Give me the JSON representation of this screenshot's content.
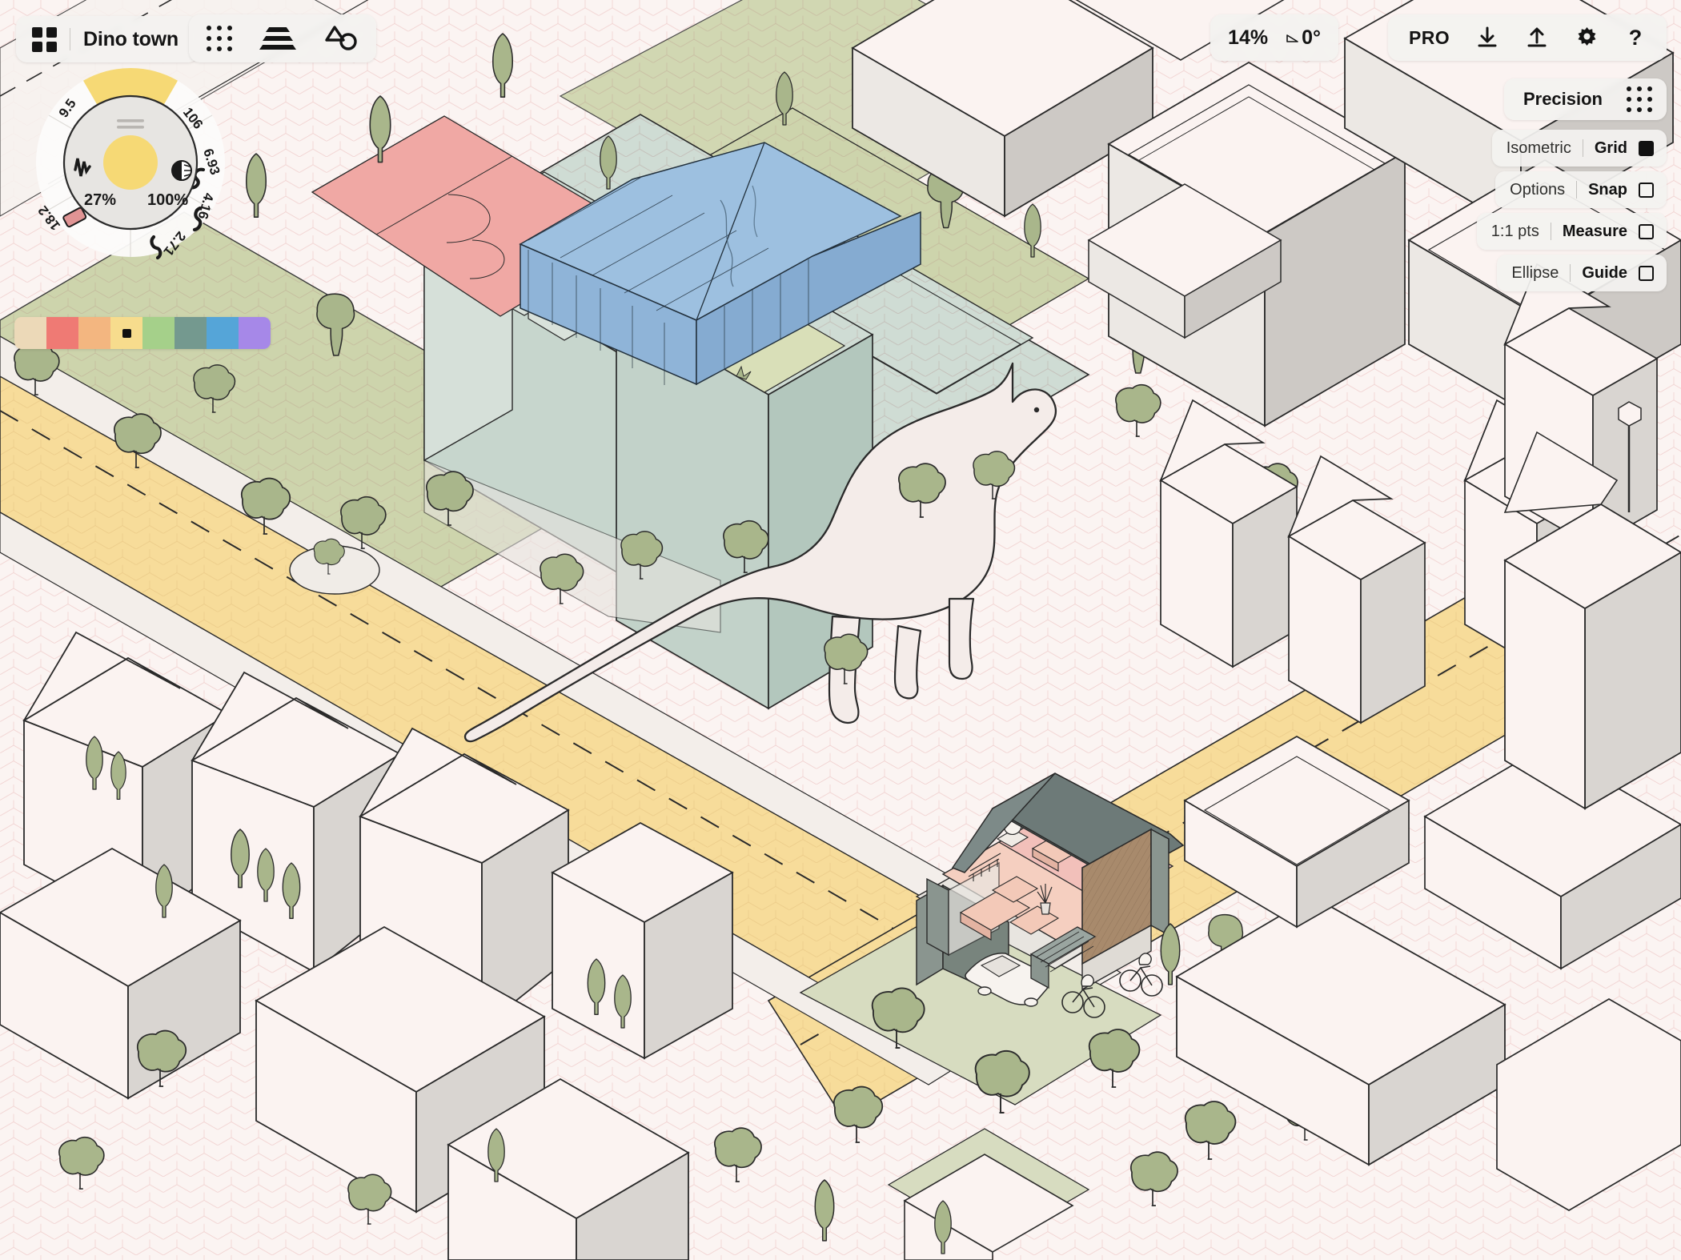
{
  "app": {
    "document_title": "Dino town",
    "apps_icon": "grid-2x2-icon"
  },
  "toolbar": {
    "tools": [
      {
        "name": "dots-grid-icon",
        "label": "Objects"
      },
      {
        "name": "layers-icon",
        "label": "Layers"
      },
      {
        "name": "shapes-icon",
        "label": "Shapes"
      }
    ]
  },
  "viewport": {
    "zoom": "14%",
    "angle": "0°",
    "angle_icon": "angle-icon"
  },
  "actions": {
    "pro_label": "PRO",
    "items": [
      {
        "name": "download-icon",
        "label": "Download"
      },
      {
        "name": "upload-icon",
        "label": "Upload"
      },
      {
        "name": "gear-icon",
        "label": "Settings"
      },
      {
        "name": "help-icon",
        "label": "Help"
      }
    ]
  },
  "precision": {
    "title": "Precision",
    "drag_handle_icon": "dots-grid-icon",
    "rows": [
      {
        "label": "Isometric",
        "value": "Grid",
        "checked": true
      },
      {
        "label": "Options",
        "value": "Snap",
        "checked": false
      },
      {
        "label": "1:1 pts",
        "value": "Measure",
        "checked": false
      },
      {
        "label": "Ellipse",
        "value": "Guide",
        "checked": false
      }
    ]
  },
  "dial": {
    "ring_labels": [
      "9.5",
      "106",
      "6.93",
      "4.16",
      "2.71",
      "18.2"
    ],
    "opacity": "27%",
    "size": "100%",
    "active_sector_icon": "brush-stroke-icon",
    "stroke_icons": [
      "stroke-wave-icon",
      "stroke-squiggle-icon",
      "stroke-zigzag-icon",
      "stroke-scribble-icon",
      "stroke-tick-icon",
      "stroke-eraser-icon"
    ],
    "left_tool_icon": "jitter-icon",
    "right_tool_icon": "contrast-icon",
    "handle_icon": "drag-handle-icon",
    "accent_color": "#f6d975"
  },
  "palette": {
    "selected_index": 3,
    "swatches": [
      {
        "name": "swatch-sand",
        "color": "#ecd9b8"
      },
      {
        "name": "swatch-red",
        "color": "#ef7a74"
      },
      {
        "name": "swatch-orange",
        "color": "#f3b680"
      },
      {
        "name": "swatch-yellow",
        "color": "#f7dc8d"
      },
      {
        "name": "swatch-green",
        "color": "#a5d08a"
      },
      {
        "name": "swatch-teal",
        "color": "#74998f"
      },
      {
        "name": "swatch-blue",
        "color": "#55a5d8"
      },
      {
        "name": "swatch-purple",
        "color": "#a688e8"
      }
    ]
  },
  "canvas": {
    "name": "isometric-city-canvas",
    "background": "#fbf4f2",
    "grid_color": "#d87878",
    "colors": {
      "road": "#f7dc9a",
      "road_edge": "#f0ebe7",
      "grass": "#cdd4ac",
      "lawn": "#d7dcc0",
      "building_face": "#fbf3f1",
      "building_shade": "#d6d2ce",
      "block_mint": "#cfdcd4",
      "block_mint_dark": "#bccdc4",
      "glass_roof": "#9dc0e0",
      "glass_roof_shade": "#89aece",
      "court_red": "#f0a8a4",
      "tree": "#a9b68b",
      "tree_dark": "#99a87c",
      "wood": "#a88a6c",
      "concrete": "#8a958f",
      "interior_pink": "#f5cfc0",
      "outline": "#1a1a1a"
    },
    "features": [
      "dinosaur-brontosaurus",
      "greenhouse-pavilion",
      "tennis-court",
      "office-block",
      "cutaway-house",
      "row-houses",
      "street-trees",
      "main-road",
      "bicycles",
      "parked-car"
    ]
  }
}
